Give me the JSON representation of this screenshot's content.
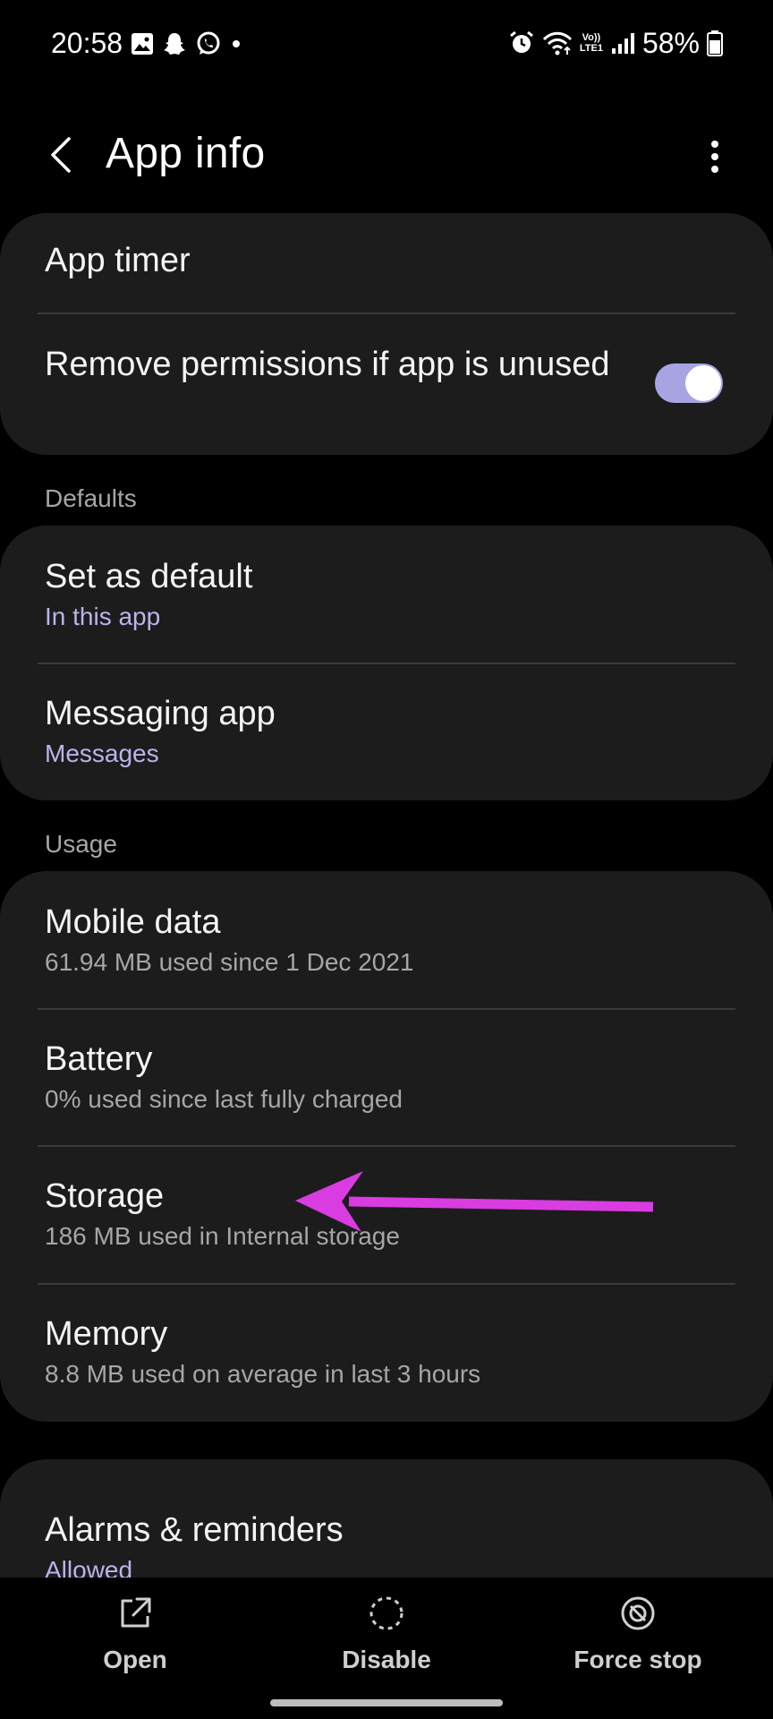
{
  "status_bar": {
    "time": "20:58",
    "left_icons": [
      "gallery-icon",
      "snapchat-icon",
      "whatsapp-icon",
      "dot-icon"
    ],
    "right_icons": [
      "alarm-icon",
      "wifi-icon",
      "volte-icon",
      "signal-icon",
      "battery-icon"
    ],
    "volte_label_top": "Vo))",
    "volte_label_bottom": "LTE1",
    "battery_percent": "58%"
  },
  "header": {
    "title": "App info",
    "back_icon": "back-arrow-icon",
    "more_icon": "more-vertical-icon"
  },
  "card_permissions": {
    "app_timer": "App timer",
    "remove_permissions": "Remove permissions if app is unused",
    "remove_permissions_enabled": true
  },
  "defaults": {
    "section_label": "Defaults",
    "set_default_title": "Set as default",
    "set_default_sub": "In this app",
    "messaging_title": "Messaging app",
    "messaging_sub": "Messages"
  },
  "usage": {
    "section_label": "Usage",
    "mobile_data_title": "Mobile data",
    "mobile_data_sub": "61.94 MB used since 1 Dec 2021",
    "battery_title": "Battery",
    "battery_sub": "0% used since last fully charged",
    "storage_title": "Storage",
    "storage_sub": "186 MB used in Internal storage",
    "memory_title": "Memory",
    "memory_sub": "8.8 MB used on average in last 3 hours"
  },
  "alarms": {
    "title": "Alarms & reminders",
    "sub": "Allowed"
  },
  "bottom_actions": {
    "open_label": "Open",
    "disable_label": "Disable",
    "force_stop_label": "Force stop"
  },
  "colors": {
    "background": "#000000",
    "card": "#1c1c1c",
    "accent_text": "#b9b4ec",
    "toggle_track": "#a8a4e4",
    "annotation_arrow": "#d93ce0"
  }
}
